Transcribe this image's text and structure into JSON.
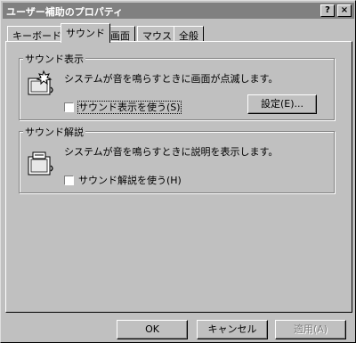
{
  "window": {
    "title": "ユーザー補助のプロパティ",
    "help_label": "?",
    "close_label": "×"
  },
  "tabs": [
    {
      "label": "キーボード",
      "active": false
    },
    {
      "label": "サウンド",
      "active": true
    },
    {
      "label": "画面",
      "active": false
    },
    {
      "label": "マウス",
      "active": false
    },
    {
      "label": "全般",
      "active": false
    }
  ],
  "sound_sentry": {
    "group_label": "サウンド表示",
    "description": "システムが音を鳴らすときに画面が点滅します。",
    "checkbox_label": "サウンド表示を使う(S)",
    "checked": false,
    "settings_button": "設定(E)..."
  },
  "show_sounds": {
    "group_label": "サウンド解説",
    "description": "システムが音を鳴らすときに説明を表示します。",
    "checkbox_label": "サウンド解説を使う(H)",
    "checked": false
  },
  "buttons": {
    "ok": "OK",
    "cancel": "キャンセル",
    "apply": "適用(A)"
  }
}
